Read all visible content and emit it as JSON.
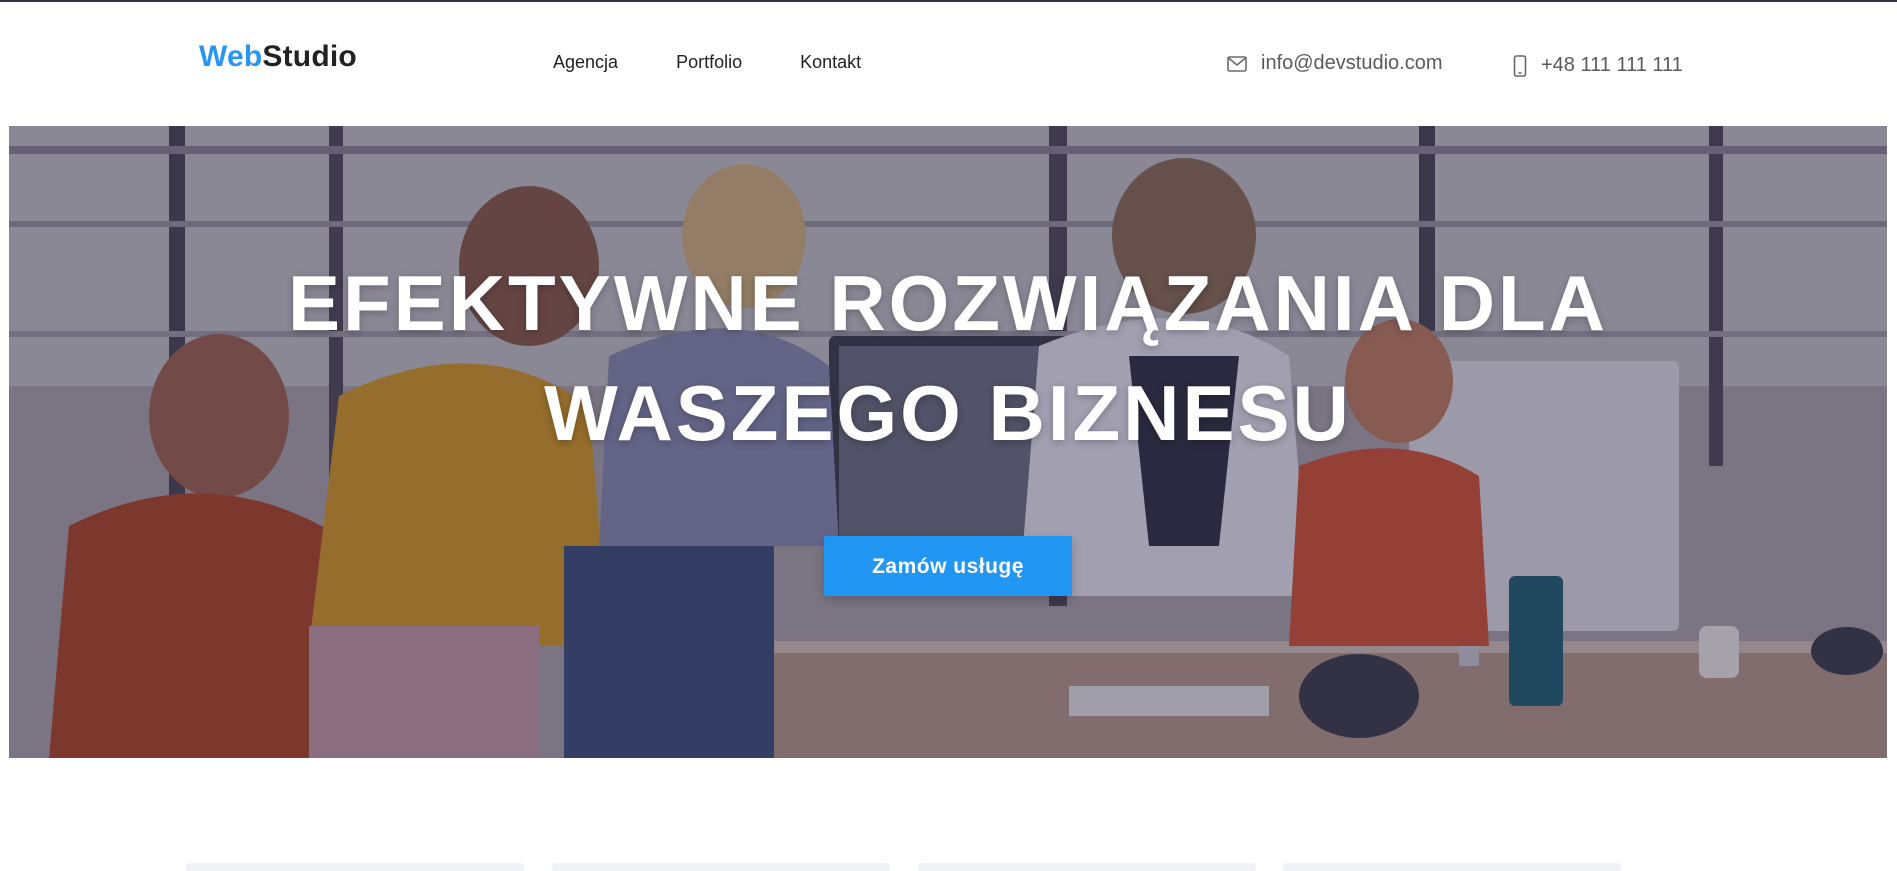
{
  "header": {
    "logo": {
      "part1": "Web",
      "part2": "Studio"
    },
    "nav": [
      {
        "label": "Agencja"
      },
      {
        "label": "Portfolio"
      },
      {
        "label": "Kontakt"
      }
    ],
    "contact": {
      "email": "info@devstudio.com",
      "email_icon": "envelope-icon",
      "phone": "+48 111 111 111",
      "phone_icon": "mobile-phone-icon"
    }
  },
  "hero": {
    "title": "EFEKTYWNE ROZWIĄZANIA DLA WASZEGO BIZNESU",
    "cta_label": "Zamów usługę"
  },
  "colors": {
    "accent": "#2196f3",
    "logo_accent": "#2b96f0",
    "text_dark": "#222222",
    "contact_text": "#5a5a5a",
    "top_border": "#2f3040"
  }
}
